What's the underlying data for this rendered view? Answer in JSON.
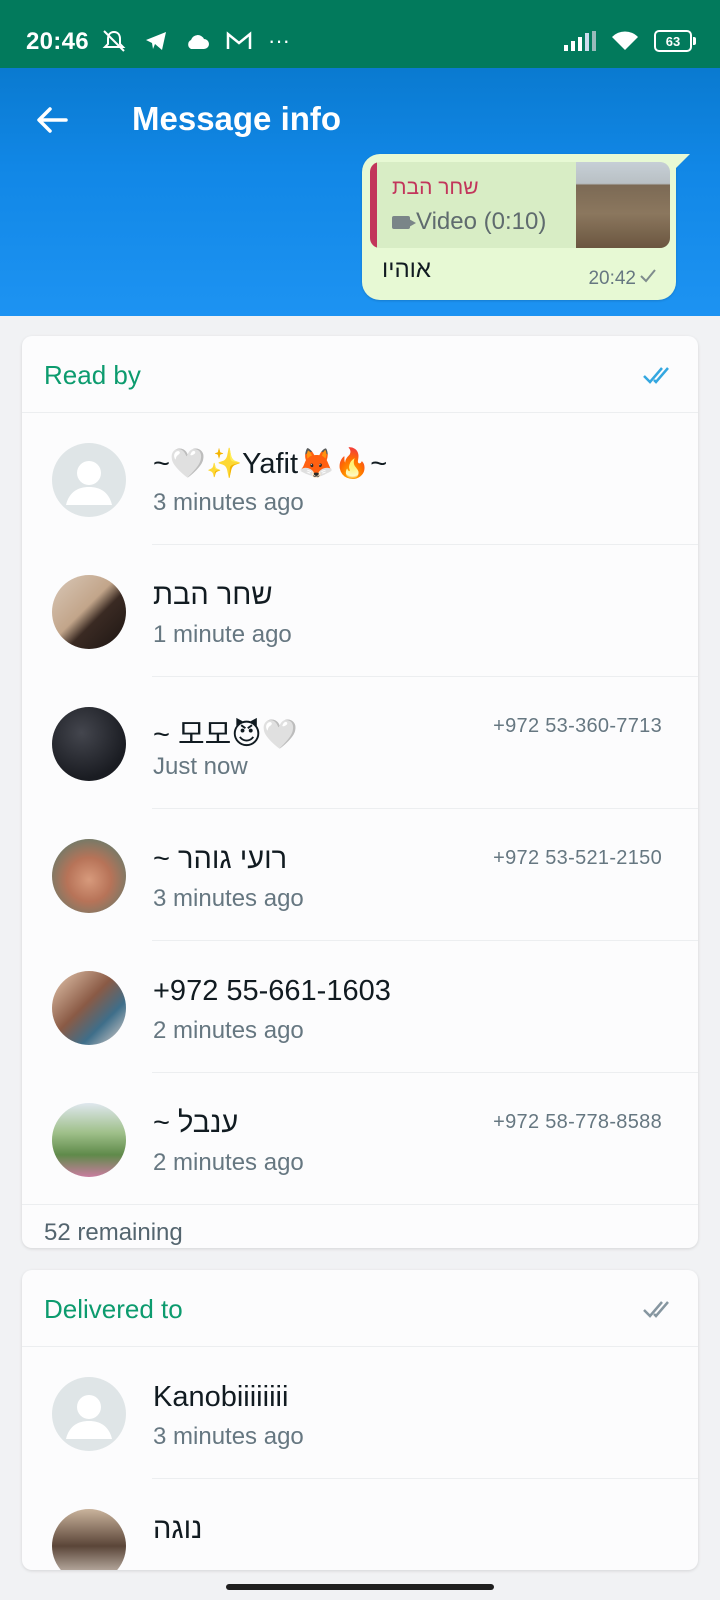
{
  "status_bar": {
    "time": "20:46",
    "battery": "63",
    "icons": [
      "mute-icon",
      "telegram-icon",
      "cloud-icon",
      "gmail-icon",
      "more-icon"
    ],
    "right_icons": [
      "signal-icon",
      "wifi-icon",
      "battery-icon"
    ],
    "more": "···"
  },
  "header": {
    "title": "Message info",
    "back_icon": "back-arrow-icon",
    "color": "#1187e6"
  },
  "message": {
    "quoted_sender": "שחר הבת",
    "quoted_type": "Video (0:10)",
    "text": "אוהיו",
    "time": "20:42"
  },
  "read_by": {
    "label": "Read by",
    "remaining": "52 remaining",
    "items": [
      {
        "name": "~🤍✨Yafit🦊🔥~",
        "when": "3 minutes ago",
        "phone": ""
      },
      {
        "name": "שחר הבת",
        "when": "1 minute ago",
        "phone": ""
      },
      {
        "name": "~ 모모😈🤍",
        "when": "Just now",
        "phone": "+972 53-360-7713"
      },
      {
        "name": "~ רועי גוהר",
        "when": "3 minutes ago",
        "phone": "+972 53-521-2150"
      },
      {
        "name": "+972 55-661-1603",
        "when": "2 minutes ago",
        "phone": ""
      },
      {
        "name": "~ ענבל",
        "when": "2 minutes ago",
        "phone": "+972 58-778-8588"
      }
    ]
  },
  "delivered_to": {
    "label": "Delivered to",
    "items": [
      {
        "name": "Kanobiiiiiiii",
        "when": "3 minutes ago"
      },
      {
        "name": "נוגה",
        "when": ""
      }
    ]
  },
  "colors": {
    "accent": "#0c9b6e",
    "read_tick": "#34a7e0",
    "status_bar": "#027a5c",
    "quote_sender": "#c2355b"
  }
}
